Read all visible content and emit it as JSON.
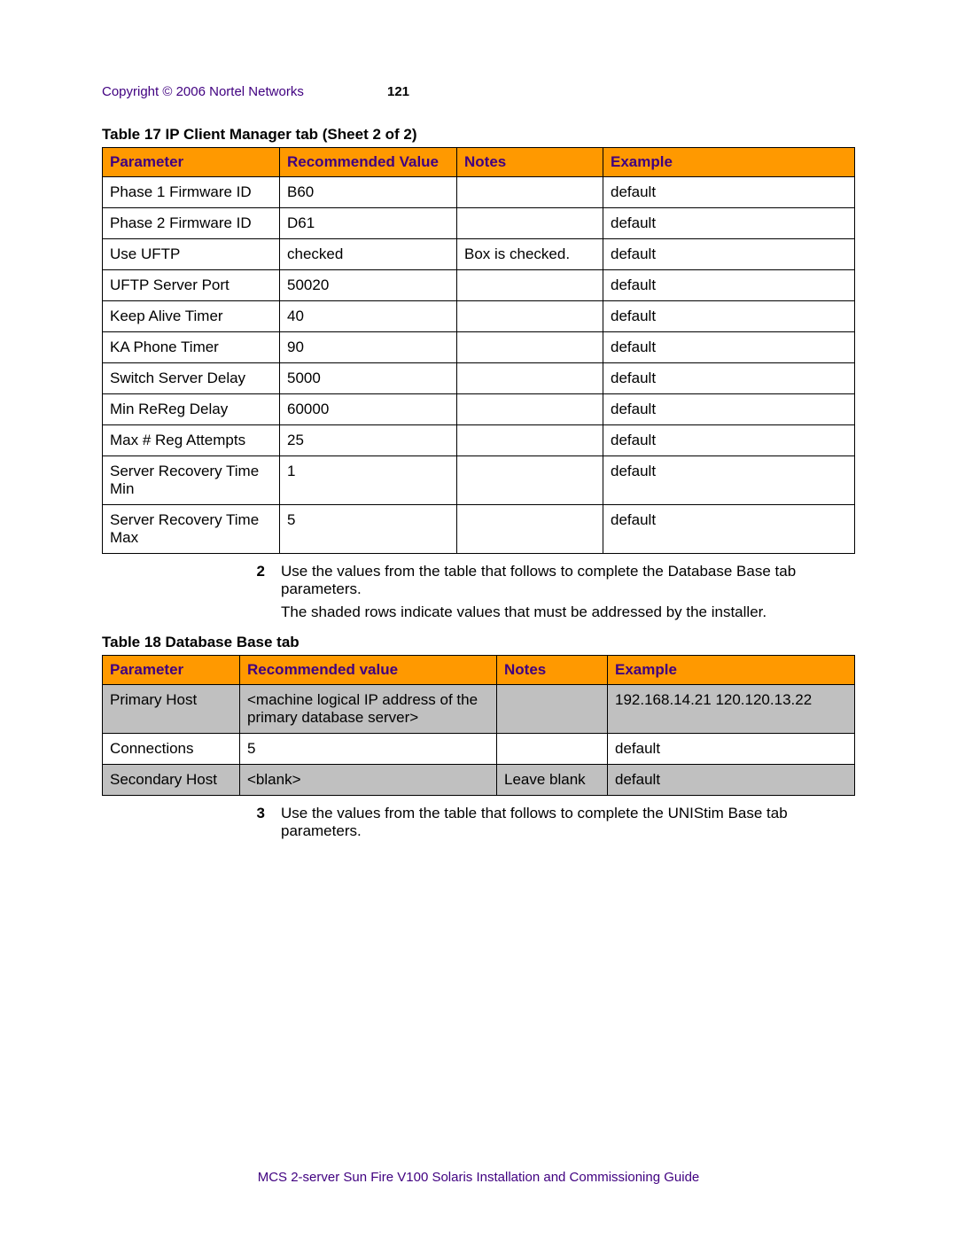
{
  "header": {
    "copyright": "Copyright © 2006 Nortel Networks",
    "pagenum": "121"
  },
  "table17": {
    "caption": "Table 17  IP Client Manager tab (Sheet 2 of 2)",
    "headers": [
      "Parameter",
      "Recommended Value",
      "Notes",
      "Example"
    ],
    "rows": [
      {
        "param": "Phase 1 Firmware ID",
        "value": "B60",
        "notes": "",
        "example": "default"
      },
      {
        "param": "Phase 2 Firmware ID",
        "value": "D61",
        "notes": "",
        "example": "default"
      },
      {
        "param": "Use UFTP",
        "value": "checked",
        "notes": "Box is checked.",
        "example": "default"
      },
      {
        "param": "UFTP Server Port",
        "value": "50020",
        "notes": "",
        "example": "default"
      },
      {
        "param": "Keep Alive Timer",
        "value": "40",
        "notes": "",
        "example": "default"
      },
      {
        "param": "KA Phone Timer",
        "value": "90",
        "notes": "",
        "example": "default"
      },
      {
        "param": "Switch Server Delay",
        "value": "5000",
        "notes": "",
        "example": "default"
      },
      {
        "param": "Min ReReg Delay",
        "value": "60000",
        "notes": "",
        "example": "default"
      },
      {
        "param": "Max # Reg Attempts",
        "value": "25",
        "notes": "",
        "example": "default"
      },
      {
        "param": "Server Recovery Time Min",
        "value": "1",
        "notes": "",
        "example": "default"
      },
      {
        "param": "Server Recovery Time Max",
        "value": "5",
        "notes": "",
        "example": "default"
      }
    ]
  },
  "step2": {
    "num": "2",
    "text": "Use the values from the table that follows to complete the Database Base tab parameters.",
    "para": "The shaded rows indicate values that must be addressed by the installer."
  },
  "table18": {
    "caption": "Table 18  Database Base tab",
    "headers": [
      "Parameter",
      "Recommended value",
      "Notes",
      "Example"
    ],
    "rows": [
      {
        "shaded": true,
        "param": "Primary Host",
        "value": "<machine logical IP address of the primary database server>",
        "notes": "",
        "example": "192.168.14.21 120.120.13.22"
      },
      {
        "shaded": false,
        "param": "Connections",
        "value": "5",
        "notes": "",
        "example": "default"
      },
      {
        "shaded": true,
        "param": "Secondary Host",
        "value": "<blank>",
        "notes": "Leave blank",
        "example": "default"
      }
    ]
  },
  "step3": {
    "num": "3",
    "text": "Use the values from the table that follows to complete the UNIStim Base tab parameters."
  },
  "footer": "MCS 2-server Sun Fire V100 Solaris Installation and Commissioning Guide"
}
